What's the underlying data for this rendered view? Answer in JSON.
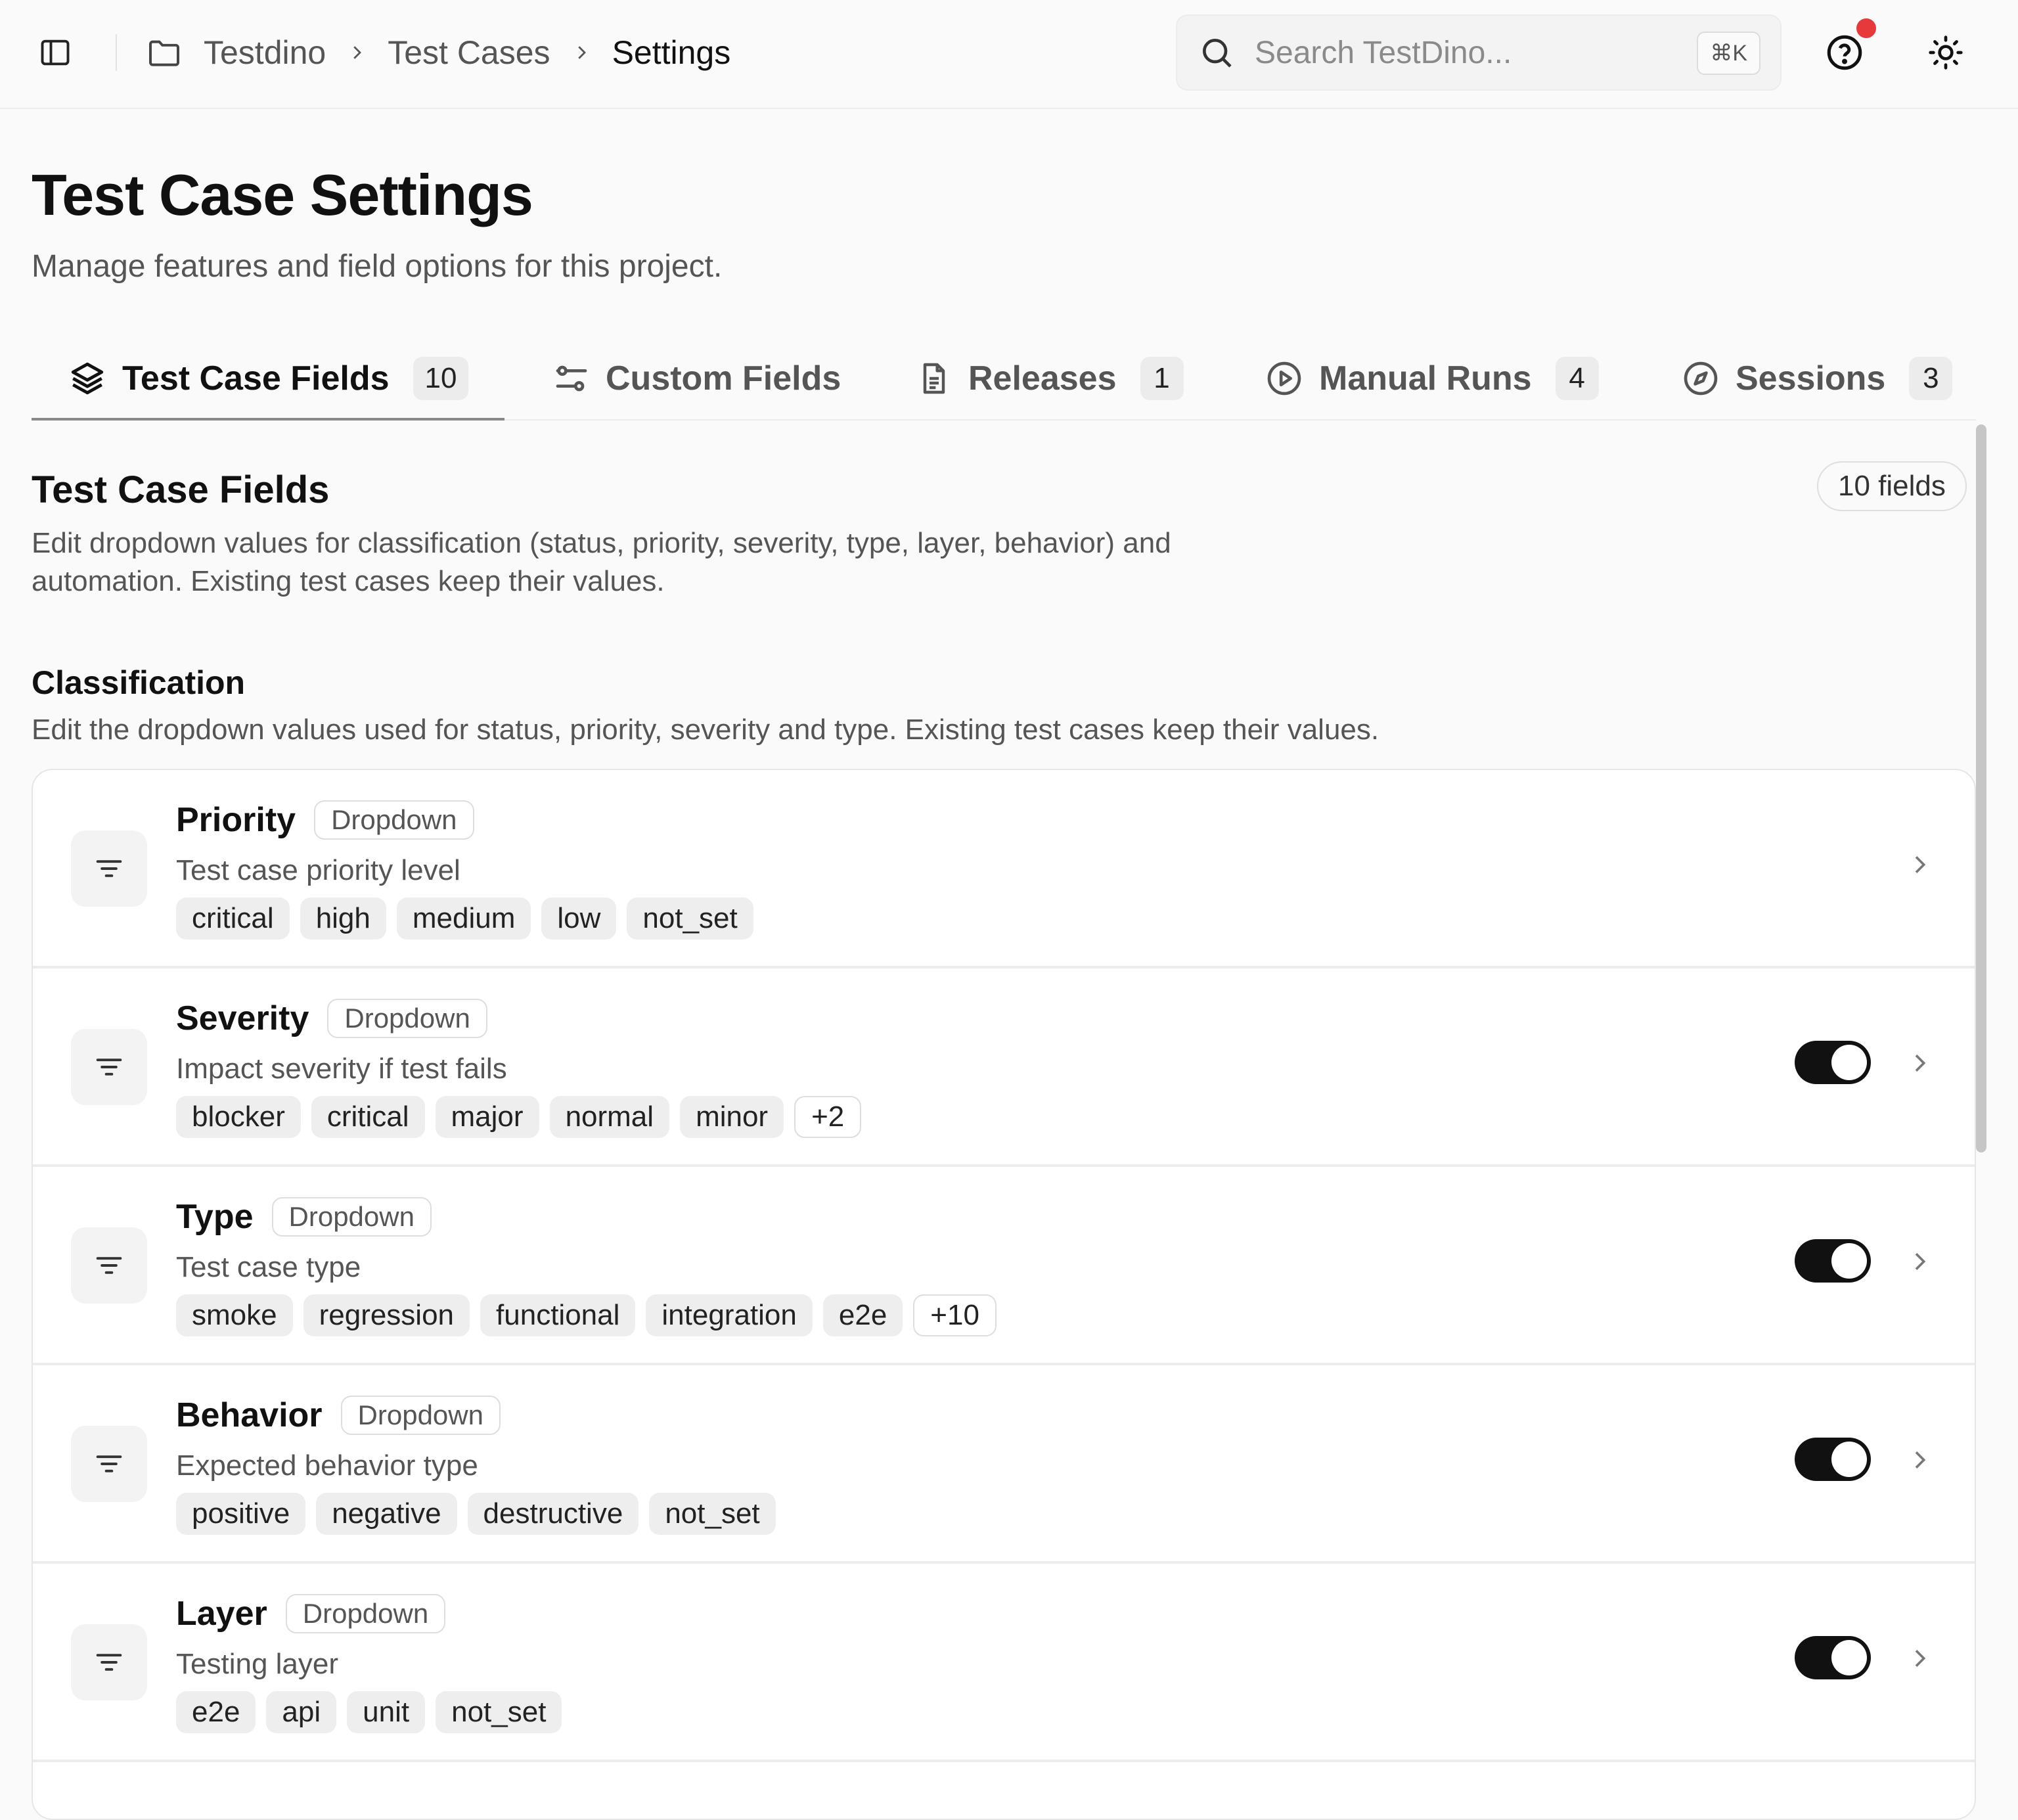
{
  "topbar": {
    "breadcrumb": [
      "Testdino",
      "Test Cases",
      "Settings"
    ],
    "search": {
      "placeholder": "Search TestDino...",
      "shortcut": "⌘K"
    },
    "icons": [
      "sidebar-toggle-icon",
      "folder-icon",
      "search-icon",
      "help-icon",
      "sun-icon"
    ],
    "notification_color": "#e5393b"
  },
  "header": {
    "title": "Test Case Settings",
    "subtitle": "Manage features and field options for this project."
  },
  "tabs": [
    {
      "label": "Test Case Fields",
      "count": "10",
      "icon": "layers-icon",
      "active": true
    },
    {
      "label": "Custom Fields",
      "count": "",
      "icon": "sliders-icon",
      "active": false
    },
    {
      "label": "Releases",
      "count": "1",
      "icon": "document-icon",
      "active": false
    },
    {
      "label": "Manual Runs",
      "count": "4",
      "icon": "play-circle-icon",
      "active": false
    },
    {
      "label": "Sessions",
      "count": "3",
      "icon": "compass-icon",
      "active": false
    }
  ],
  "section": {
    "title": "Test Case Fields",
    "badge": "10 fields",
    "description_line1": "Edit dropdown values for classification (status, priority, severity, type, layer, behavior) and",
    "description_line2": "automation. Existing test cases keep their values."
  },
  "classification": {
    "title": "Classification",
    "description": "Edit the dropdown values used for status, priority, severity and type. Existing test cases keep their values.",
    "fields": [
      {
        "name": "Priority",
        "type": "Dropdown",
        "description": "Test case priority level",
        "values": [
          "critical",
          "high",
          "medium",
          "low",
          "not_set"
        ],
        "more": "",
        "toggle": null
      },
      {
        "name": "Severity",
        "type": "Dropdown",
        "description": "Impact severity if test fails",
        "values": [
          "blocker",
          "critical",
          "major",
          "normal",
          "minor"
        ],
        "more": "+2",
        "toggle": true
      },
      {
        "name": "Type",
        "type": "Dropdown",
        "description": "Test case type",
        "values": [
          "smoke",
          "regression",
          "functional",
          "integration",
          "e2e"
        ],
        "more": "+10",
        "toggle": true
      },
      {
        "name": "Behavior",
        "type": "Dropdown",
        "description": "Expected behavior type",
        "values": [
          "positive",
          "negative",
          "destructive",
          "not_set"
        ],
        "more": "",
        "toggle": true
      },
      {
        "name": "Layer",
        "type": "Dropdown",
        "description": "Testing layer",
        "values": [
          "e2e",
          "api",
          "unit",
          "not_set"
        ],
        "more": "",
        "toggle": true
      }
    ]
  }
}
